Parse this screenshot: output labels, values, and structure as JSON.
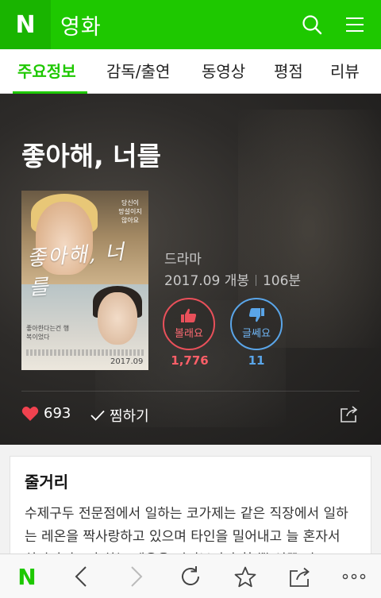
{
  "header": {
    "logo": "N",
    "title": "영화",
    "icons": [
      "search-icon",
      "menu-icon"
    ]
  },
  "tabs": [
    {
      "label": "주요정보",
      "active": true
    },
    {
      "label": "감독/출연",
      "active": false
    },
    {
      "label": "동영상",
      "active": false
    },
    {
      "label": "평점",
      "active": false
    },
    {
      "label": "리뷰",
      "active": false
    }
  ],
  "movie": {
    "title": "좋아해, 너를",
    "genre": "드라마",
    "release": "2017.09 개봉",
    "runtime": "106분",
    "poster": {
      "script_title": "좋아해, 너를",
      "tagline_vertical": "당신이 망설이지 않아요",
      "tagline_small": "좋아한다는건 행복이었다",
      "date": "2017.09"
    },
    "like": {
      "label": "볼래요",
      "count": "1,776"
    },
    "dislike": {
      "label": "글쎄요",
      "count": "11"
    },
    "hearts": "693",
    "zzim_label": "찜하기"
  },
  "synopsis": {
    "heading": "줄거리",
    "text": "수제구두 전문점에서 일하는 코가제는 같은 직장에서 일하는 레온을 짝사랑하고 있으며 타인을 밀어내고 늘 혼자서 살아가려고만 하는 레온을 지켜보기만 할 뿐 선뜻 다"
  },
  "colors": {
    "brand_green": "#1ec800",
    "like_red": "#e9505a",
    "dislike_blue": "#5aa5e8"
  },
  "bottombar": {
    "logo": "N",
    "icons": [
      "naver-home-icon",
      "back-icon",
      "forward-icon",
      "refresh-icon",
      "star-icon",
      "share-icon",
      "more-icon"
    ]
  }
}
